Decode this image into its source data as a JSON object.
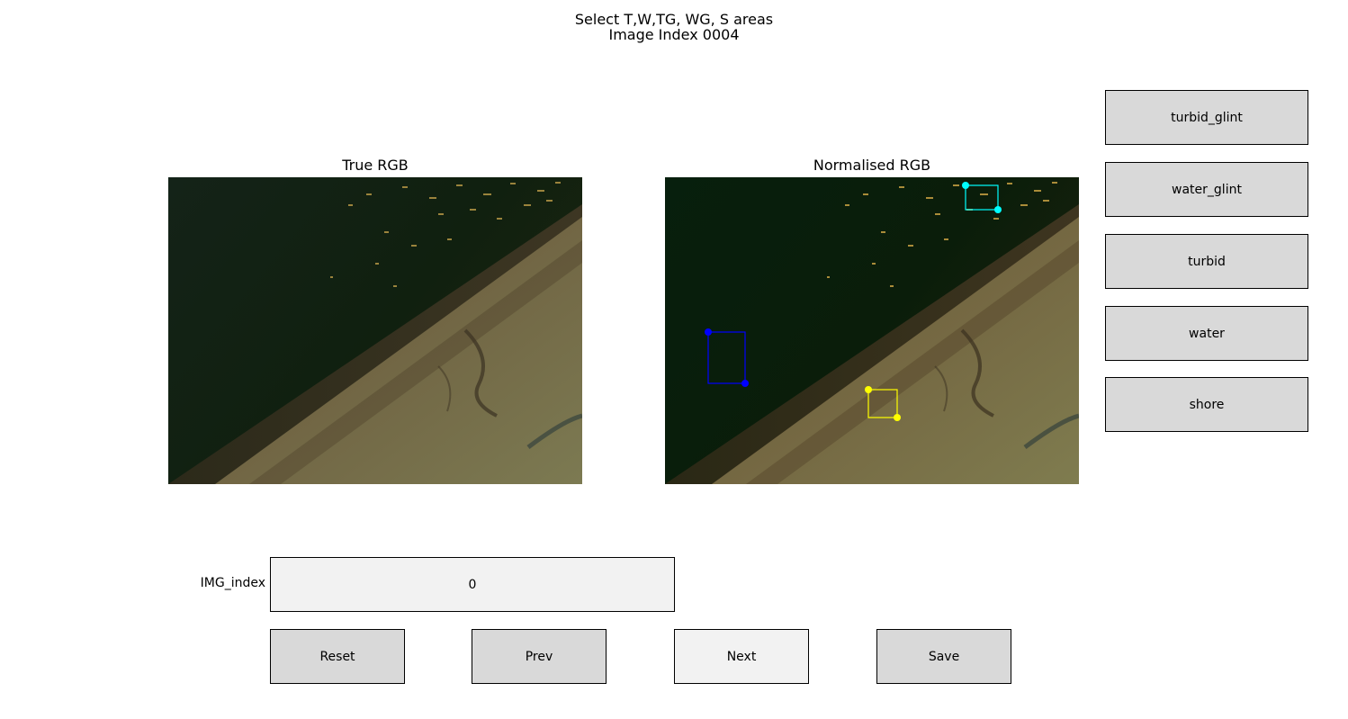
{
  "suptitle": {
    "line1": "Select T,W,TG, WG, S areas",
    "line2": "Image Index 0004"
  },
  "panels": {
    "left_title": "True RGB",
    "right_title": "Normalised RGB"
  },
  "selections": [
    {
      "class": "turbid_glint",
      "color": "#00ffff"
    },
    {
      "class": "water",
      "color": "#0000ff"
    },
    {
      "class": "shore",
      "color": "#ffff00"
    }
  ],
  "side_buttons": {
    "turbid_glint": "turbid_glint",
    "water_glint": "water_glint",
    "turbid": "turbid",
    "water": "water",
    "shore": "shore"
  },
  "img_index": {
    "label": "IMG_index",
    "value": "0"
  },
  "bottom_buttons": {
    "reset": "Reset",
    "prev": "Prev",
    "next": "Next",
    "save": "Save"
  }
}
